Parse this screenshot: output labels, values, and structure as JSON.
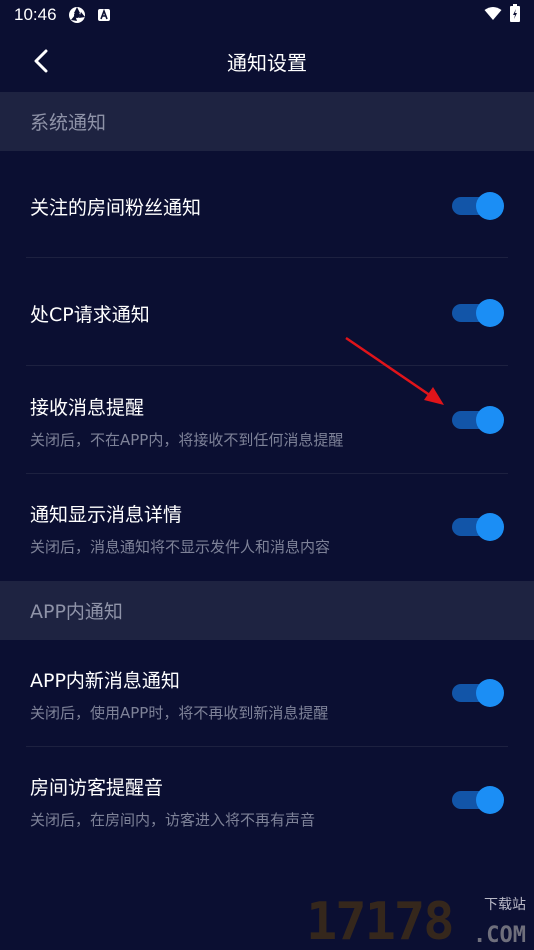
{
  "status_bar": {
    "time": "10:46",
    "icons": [
      "app-notification-icon",
      "a-icon",
      "wifi-icon",
      "battery-icon"
    ]
  },
  "header": {
    "title": "通知设置"
  },
  "sections": [
    {
      "title": "系统通知",
      "items": [
        {
          "title": "关注的房间粉丝通知",
          "subtitle": "",
          "enabled": true
        },
        {
          "title": "处CP请求通知",
          "subtitle": "",
          "enabled": true
        },
        {
          "title": "接收消息提醒",
          "subtitle": "关闭后，不在APP内，将接收不到任何消息提醒",
          "enabled": true
        },
        {
          "title": "通知显示消息详情",
          "subtitle": "关闭后，消息通知将不显示发件人和消息内容",
          "enabled": true
        }
      ]
    },
    {
      "title": "APP内通知",
      "items": [
        {
          "title": "APP内新消息通知",
          "subtitle": "关闭后，使用APP时，将不再收到新消息提醒",
          "enabled": true
        },
        {
          "title": "房间访客提醒音",
          "subtitle": "关闭后，在房间内，访客进入将不再有声音",
          "enabled": true
        }
      ]
    }
  ],
  "watermark": {
    "digits": "17178",
    "top_text": "下载站",
    "bottom_text": ".COM"
  },
  "colors": {
    "background": "#0b0f32",
    "section_bg": "#1e2341",
    "toggle_track": "#1255a8",
    "toggle_knob": "#1b8ef5",
    "annotation_arrow": "#e0141a"
  }
}
